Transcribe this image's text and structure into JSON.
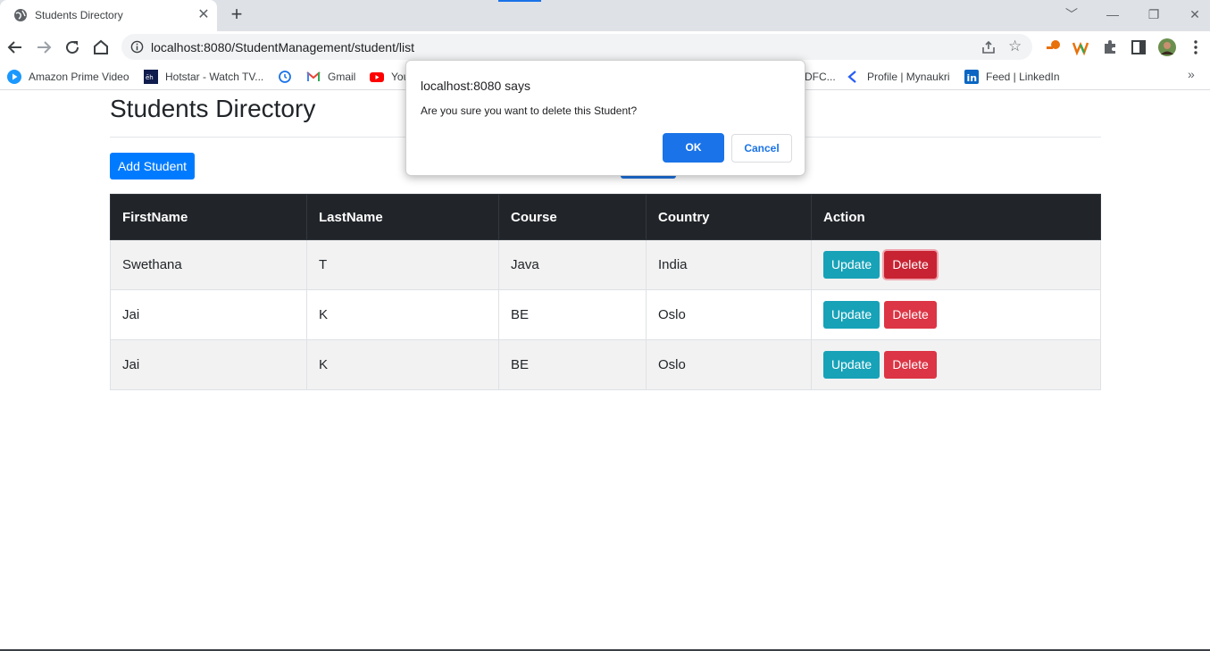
{
  "browser": {
    "tab_title": "Students Directory",
    "tab_close": "✕",
    "new_tab": "+",
    "url": "localhost:8080/StudentManagement/student/list",
    "window_controls": [
      "﹀",
      "—",
      "❐",
      "✕"
    ],
    "bookmarks": [
      {
        "label": "Amazon Prime Video",
        "icon": "prime-video-icon"
      },
      {
        "label": "Hotstar - Watch TV...",
        "icon": "hotstar-icon"
      },
      {
        "label": "",
        "icon": "history-icon"
      },
      {
        "label": "Gmail",
        "icon": "gmail-icon"
      },
      {
        "label": "You",
        "icon": "youtube-icon"
      },
      {
        "label": "DFC...",
        "icon": "hdfc-icon"
      },
      {
        "label": "Profile | Mynaukri",
        "icon": "naukri-icon"
      },
      {
        "label": "Feed | LinkedIn",
        "icon": "linkedin-icon"
      }
    ],
    "more_bookmarks": "»"
  },
  "page": {
    "heading": "Students Directory",
    "add_button": "Add Student",
    "table": {
      "headers": [
        "FirstName",
        "LastName",
        "Course",
        "Country",
        "Action"
      ],
      "rows": [
        {
          "first": "Swethana",
          "last": "T",
          "course": "Java",
          "country": "India"
        },
        {
          "first": "Jai",
          "last": "K",
          "course": "BE",
          "country": "Oslo"
        },
        {
          "first": "Jai",
          "last": "K",
          "course": "BE",
          "country": "Oslo"
        }
      ],
      "update_label": "Update",
      "delete_label": "Delete"
    }
  },
  "dialog": {
    "title": "localhost:8080 says",
    "message": "Are you sure you want to delete this Student?",
    "ok": "OK",
    "cancel": "Cancel"
  },
  "colors": {
    "primary": "#007bff",
    "info": "#17a2b8",
    "danger": "#dc3545",
    "header_dark": "#212529",
    "chrome_blue": "#1a73e8"
  }
}
